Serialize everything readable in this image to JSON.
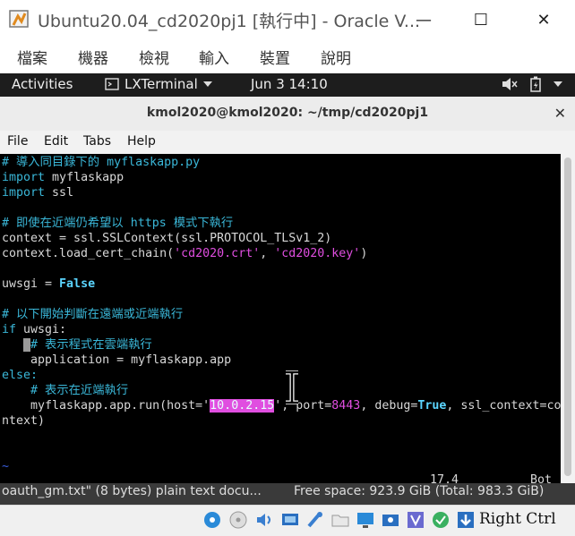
{
  "window": {
    "title": "Ubuntu20.04_cd2020pj1 [執行中] - Oracle V...",
    "minimize": "—",
    "maximize": "☐",
    "close": "✕"
  },
  "vb_menu": [
    "檔案",
    "機器",
    "檢視",
    "輸入",
    "裝置",
    "說明"
  ],
  "topbar": {
    "activities": "Activities",
    "app": "LXTerminal",
    "clock": "Jun 3  14:10"
  },
  "terminal": {
    "title": "kmol2020@kmol2020: ~/tmp/cd2020pj1",
    "menu": [
      "File",
      "Edit",
      "Tabs",
      "Help"
    ],
    "lines": {
      "l1": "# 導入同目錄下的 myflaskapp.py",
      "l2a": "import",
      "l2b": " myflaskapp",
      "l3a": "import",
      "l3b": " ssl",
      "l5": "# 即使在近端仍希望以 https 模式下執行",
      "l6": "context = ssl.SSLContext(ssl.PROTOCOL_TLSv1_2)",
      "l7a": "context.load_cert_chain(",
      "l7b": "'cd2020.crt'",
      "l7c": ", ",
      "l7d": "'cd2020.key'",
      "l7e": ")",
      "l9a": "uwsgi = ",
      "l9b": "False",
      "l11": "# 以下開始判斷在遠端或近端執行",
      "l12a": "if",
      "l12b": " uwsgi:",
      "l13a": "   ",
      "l13b": " ",
      "l13c": "# 表示程式在雲端執行",
      "l14": "    application = myflaskapp.app",
      "l15": "else:",
      "l16": "    # 表示在近端執行",
      "l17a": "    myflaskapp.app.run(host='",
      "l17b": "10.0.2.15",
      "l17c": "', port=",
      "l17d": "8443",
      "l17e": ", debug=",
      "l17f": "True",
      "l17g": ", ssl_context=co",
      "l18": "ntext)",
      "tilde": "~"
    },
    "position": "17,4",
    "scroll": "Bot"
  },
  "behind": {
    "file": " oauth_gm.txt\" (8 bytes) plain text docu...",
    "space": "Free space: 923.9 GiB (Total: 983.3 GiB)"
  },
  "vb_status": {
    "host_key": "Right Ctrl"
  }
}
